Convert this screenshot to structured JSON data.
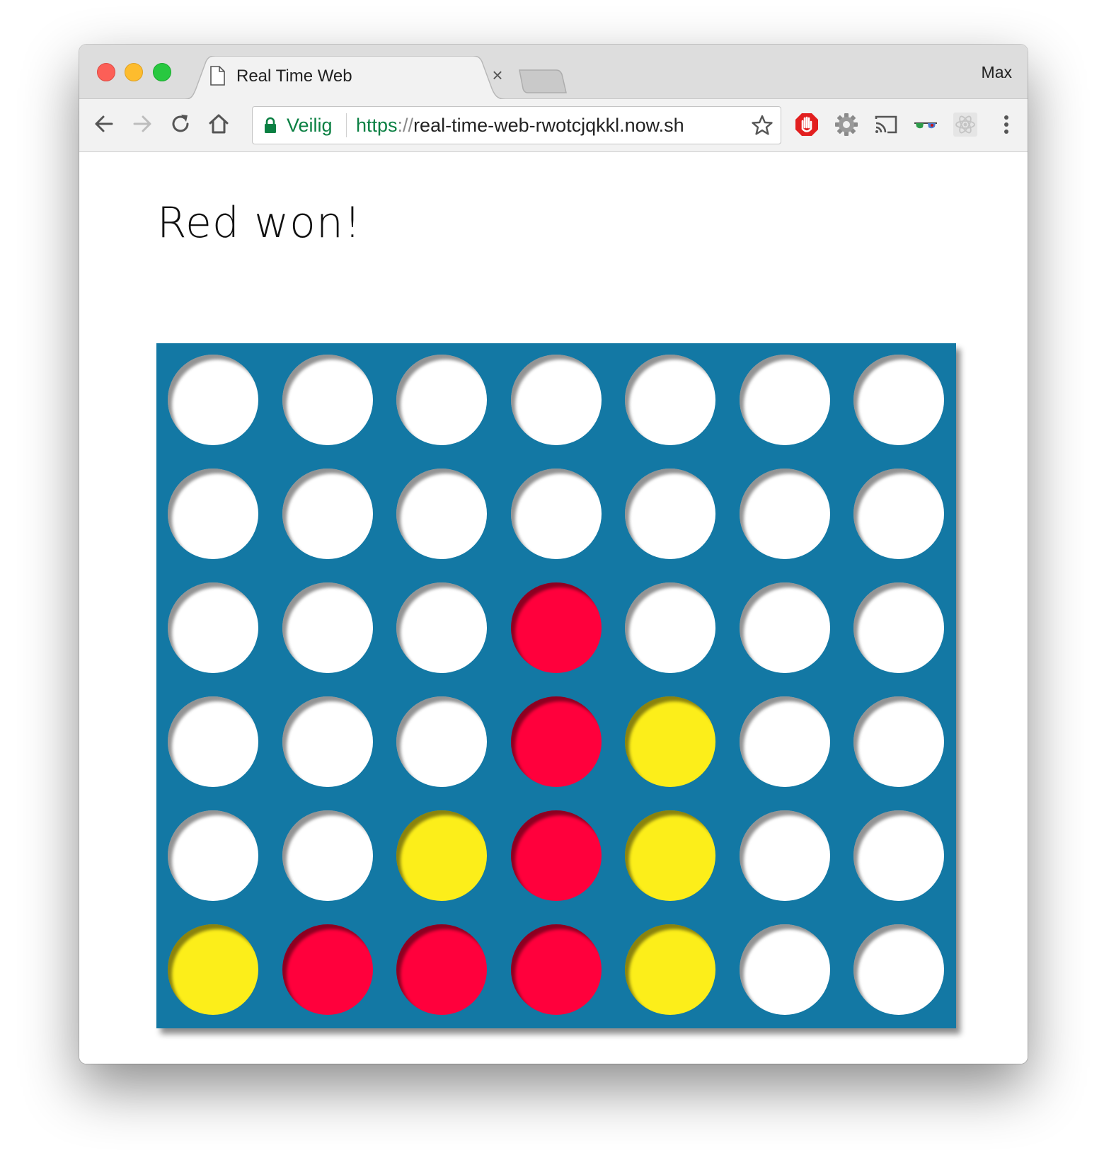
{
  "browser": {
    "tab_title": "Real Time Web",
    "profile_name": "Max",
    "secure_label": "Veilig",
    "url_scheme": "https",
    "url_separator": "://",
    "url_host": "real-time-web-rwotcjqkkl.now.sh",
    "icons": {
      "back": "back-arrow-icon",
      "forward": "forward-arrow-icon",
      "reload": "reload-icon",
      "home": "home-icon",
      "lock": "lock-icon",
      "bookmark": "star-icon",
      "extensions": [
        "adblock-hand-icon",
        "gear-icon",
        "cast-icon",
        "glasses-icon",
        "react-atom-icon"
      ],
      "menu": "kebab-menu-icon"
    }
  },
  "game": {
    "status": "Red won!",
    "colors": {
      "board": "#1378a4",
      "red": "#ff003c",
      "yellow": "#fcee1a",
      "empty": "#ffffff"
    },
    "rows": 6,
    "columns": 7,
    "grid": [
      [
        "empty",
        "empty",
        "empty",
        "empty",
        "empty",
        "empty",
        "empty"
      ],
      [
        "empty",
        "empty",
        "empty",
        "empty",
        "empty",
        "empty",
        "empty"
      ],
      [
        "empty",
        "empty",
        "empty",
        "red",
        "empty",
        "empty",
        "empty"
      ],
      [
        "empty",
        "empty",
        "empty",
        "red",
        "yellow",
        "empty",
        "empty"
      ],
      [
        "empty",
        "empty",
        "yellow",
        "red",
        "yellow",
        "empty",
        "empty"
      ],
      [
        "yellow",
        "red",
        "red",
        "red",
        "yellow",
        "empty",
        "empty"
      ]
    ]
  }
}
